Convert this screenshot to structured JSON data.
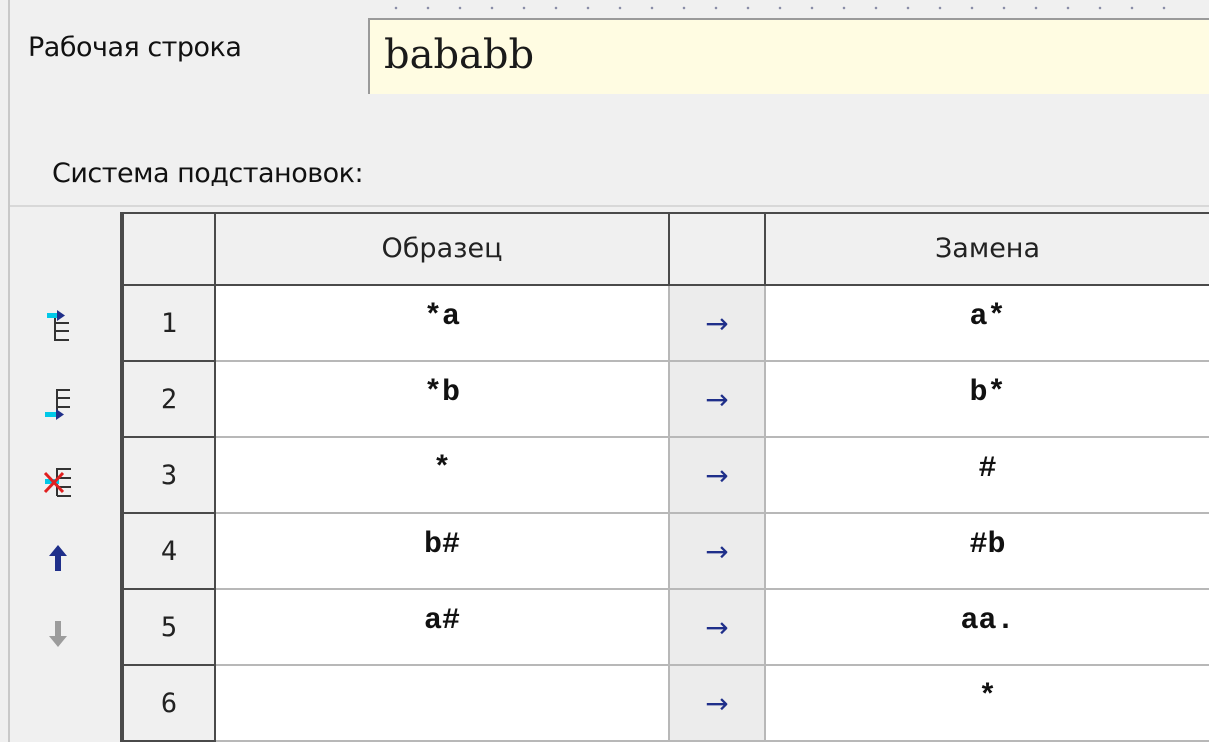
{
  "work_string": {
    "label": "Рабочая строка",
    "value": "bababb"
  },
  "system": {
    "label": "Система подстановок:"
  },
  "toolbar": {
    "buttons": [
      {
        "name": "insert-row-before-icon"
      },
      {
        "name": "insert-row-after-icon"
      },
      {
        "name": "delete-row-icon"
      },
      {
        "name": "move-up-icon"
      },
      {
        "name": "move-down-icon",
        "disabled": true
      }
    ]
  },
  "table": {
    "headers": {
      "num": "",
      "pattern": "Образец",
      "arrow": "",
      "replacement": "Замена"
    },
    "rows": [
      {
        "num": "1",
        "pattern": "*a",
        "arrow": "→",
        "replacement": "a*"
      },
      {
        "num": "2",
        "pattern": "*b",
        "arrow": "→",
        "replacement": "b*"
      },
      {
        "num": "3",
        "pattern": "*",
        "arrow": "→",
        "replacement": "#"
      },
      {
        "num": "4",
        "pattern": "b#",
        "arrow": "→",
        "replacement": "#b"
      },
      {
        "num": "5",
        "pattern": "a#",
        "arrow": "→",
        "replacement": "aa."
      },
      {
        "num": "6",
        "pattern": "",
        "arrow": "→",
        "replacement": "*"
      }
    ]
  },
  "colors": {
    "input_bg": "#fffce2",
    "arrow": "#1f2f8a",
    "accent_cyan": "#00c8e8",
    "delete_red": "#e02020"
  }
}
